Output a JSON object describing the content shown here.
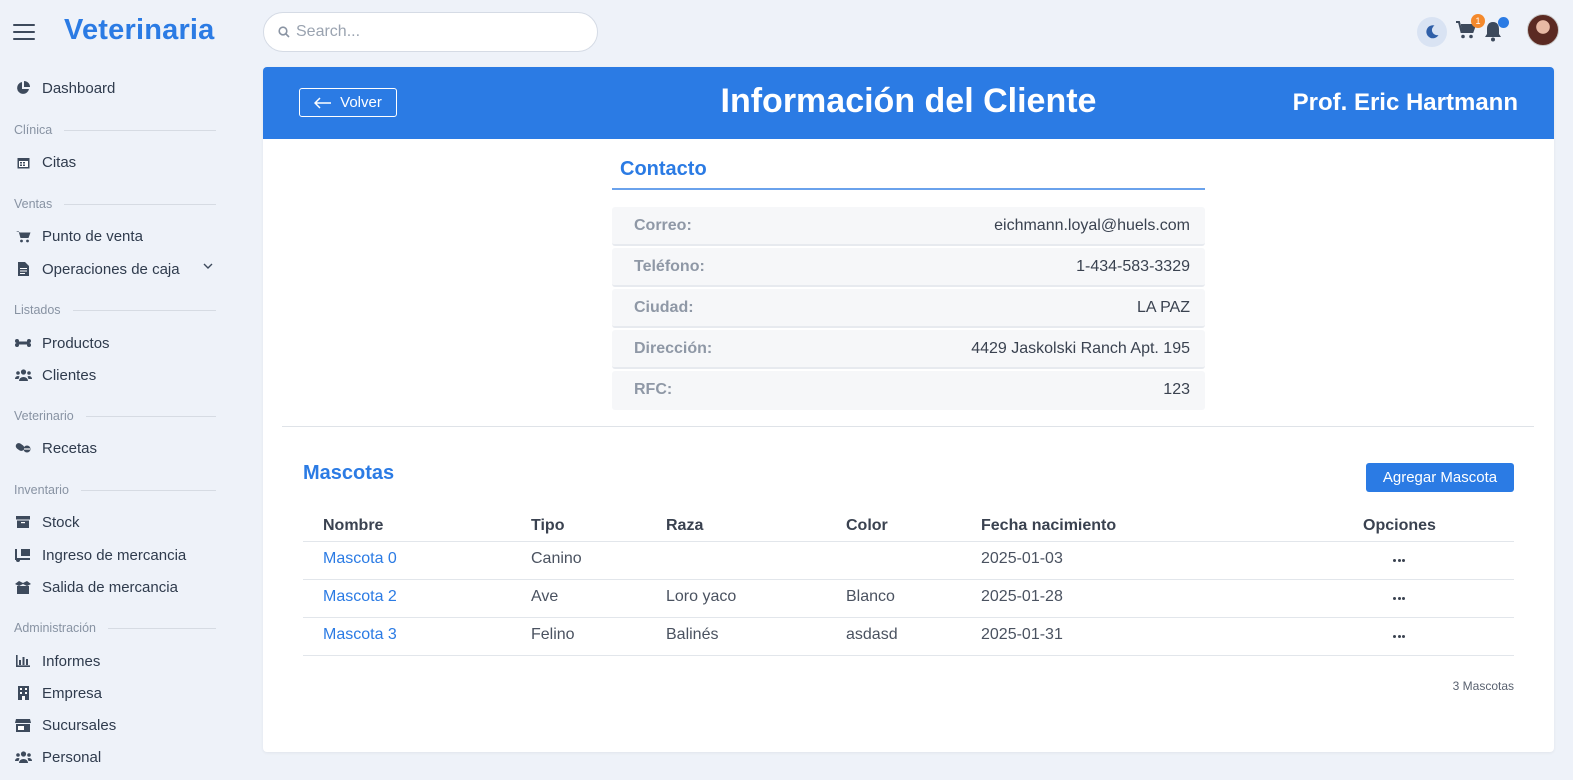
{
  "app": {
    "brand": "Veterinaria",
    "search_placeholder": "Search...",
    "cart_count": "1"
  },
  "sidebar": {
    "dashboard": "Dashboard",
    "sections": {
      "clinica": "Clínica",
      "ventas": "Ventas",
      "listados": "Listados",
      "veterinario": "Veterinario",
      "inventario": "Inventario",
      "administracion": "Administración"
    },
    "items": {
      "citas": "Citas",
      "punto_venta": "Punto de venta",
      "operaciones_caja": "Operaciones de caja",
      "productos": "Productos",
      "clientes": "Clientes",
      "recetas": "Recetas",
      "stock": "Stock",
      "ingreso": "Ingreso de mercancia",
      "salida": "Salida de mercancia",
      "informes": "Informes",
      "empresa": "Empresa",
      "sucursales": "Sucursales",
      "personal": "Personal"
    }
  },
  "header": {
    "back_label": "Volver",
    "title": "Información del Cliente",
    "client_name": "Prof. Eric Hartmann"
  },
  "contact": {
    "title": "Contacto",
    "rows": [
      {
        "label": "Correo:",
        "value": "eichmann.loyal@huels.com"
      },
      {
        "label": "Teléfono:",
        "value": "1-434-583-3329"
      },
      {
        "label": "Ciudad:",
        "value": "LA PAZ"
      },
      {
        "label": "Dirección:",
        "value": "4429 Jaskolski Ranch Apt. 195"
      },
      {
        "label": "RFC:",
        "value": "123"
      }
    ]
  },
  "pets": {
    "title": "Mascotas",
    "add_label": "Agregar Mascota",
    "columns": [
      "Nombre",
      "Tipo",
      "Raza",
      "Color",
      "Fecha nacimiento",
      "Opciones"
    ],
    "rows": [
      [
        "Mascota 0",
        "Canino",
        "",
        "",
        "2025-01-03"
      ],
      [
        "Mascota 2",
        "Ave",
        "Loro yaco",
        "Blanco",
        "2025-01-28"
      ],
      [
        "Mascota 3",
        "Felino",
        "Balinés",
        "asdasd",
        "2025-01-31"
      ]
    ],
    "count_label": "3 Mascotas"
  },
  "colors": {
    "accent": "#2b7be4",
    "badge": "#f4892c",
    "background": "#eef2f9"
  }
}
